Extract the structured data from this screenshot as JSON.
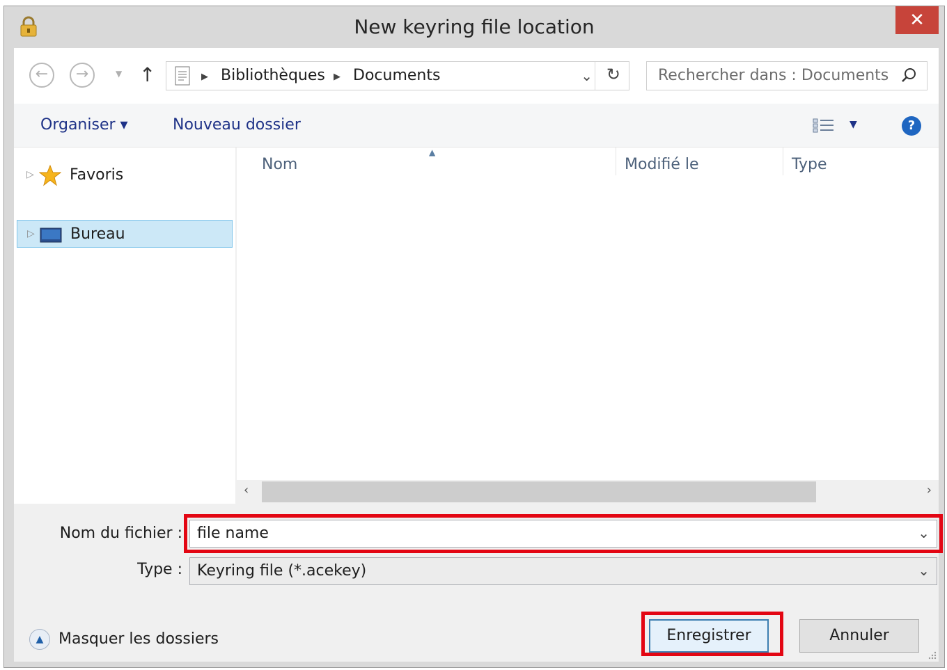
{
  "window": {
    "title": "New keyring file location",
    "close_label": "✕"
  },
  "nav": {
    "breadcrumbs": [
      "Bibliothèques",
      "Documents"
    ],
    "search_placeholder": "Rechercher dans : Documents"
  },
  "toolbar": {
    "organize": "Organiser ▾",
    "new_folder": "Nouveau dossier",
    "help": "?"
  },
  "tree": {
    "items": [
      {
        "label": "Favoris",
        "icon": "star-icon"
      },
      {
        "label": "Bureau",
        "icon": "desktop-icon",
        "selected": true
      }
    ]
  },
  "list": {
    "columns": [
      "Nom",
      "Modifié le",
      "Type"
    ]
  },
  "form": {
    "filename_label": "Nom du fichier :",
    "filename_value": "file name",
    "type_label": "Type :",
    "type_value": "Keyring file (*.acekey)"
  },
  "footer": {
    "hide_folders": "Masquer les dossiers",
    "save": "Enregistrer",
    "cancel": "Annuler"
  },
  "colors": {
    "highlight": "#e30613",
    "close_button": "#c7443a",
    "selection": "#cce8f7"
  }
}
